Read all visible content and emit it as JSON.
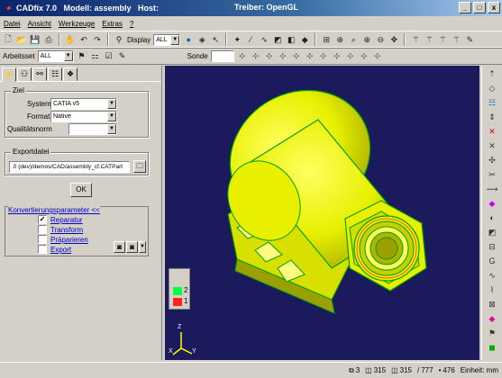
{
  "window": {
    "title": "CADfix 7.0   Modell: assembly   Host:",
    "driver": "Treiber: OpenGL",
    "controls": [
      "_",
      "□",
      "x"
    ]
  },
  "menu": [
    "Datei",
    "Ansicht",
    "Werkzeuge",
    "Extras",
    "?"
  ],
  "toolbar": {
    "display_label": "Display",
    "display_value": "ALL"
  },
  "toolbar2": {
    "workset_label": "Arbeitsset",
    "workset_value": "ALL",
    "probe_label": "Sonde"
  },
  "panel": {
    "target": {
      "title": "Ziel",
      "system_label": "System",
      "system_value": "CATIA v5",
      "format_label": "Format",
      "format_value": "Native",
      "quality_label": "Qualitätsnorm",
      "quality_value": ""
    },
    "export": {
      "title": "Exportdatei",
      "path": ".0 (dev)/demos/CAD/assembly_cf.CATPart"
    },
    "ok_label": "OK",
    "conversion": {
      "link": "Konvertierungsparameter <<",
      "options": [
        {
          "label": "Reparatur",
          "checked": true
        },
        {
          "label": "Transform",
          "checked": false
        },
        {
          "label": "Präparieren",
          "checked": false
        },
        {
          "label": "Export",
          "checked": false
        }
      ]
    }
  },
  "legend": [
    {
      "label": "2",
      "color": "#00ff40"
    },
    {
      "label": "1",
      "color": "#ff2020"
    }
  ],
  "axes": {
    "x": "X",
    "y": "Y",
    "z": "Z"
  },
  "status": {
    "s1": "3",
    "s2": "315",
    "s3": "315",
    "s4": "777",
    "s5": "476",
    "units": "Einheit: mm"
  },
  "colors": {
    "viewport_bg": "#1a1a5c",
    "model": "#e8f000",
    "model_edge": "#00c000"
  }
}
